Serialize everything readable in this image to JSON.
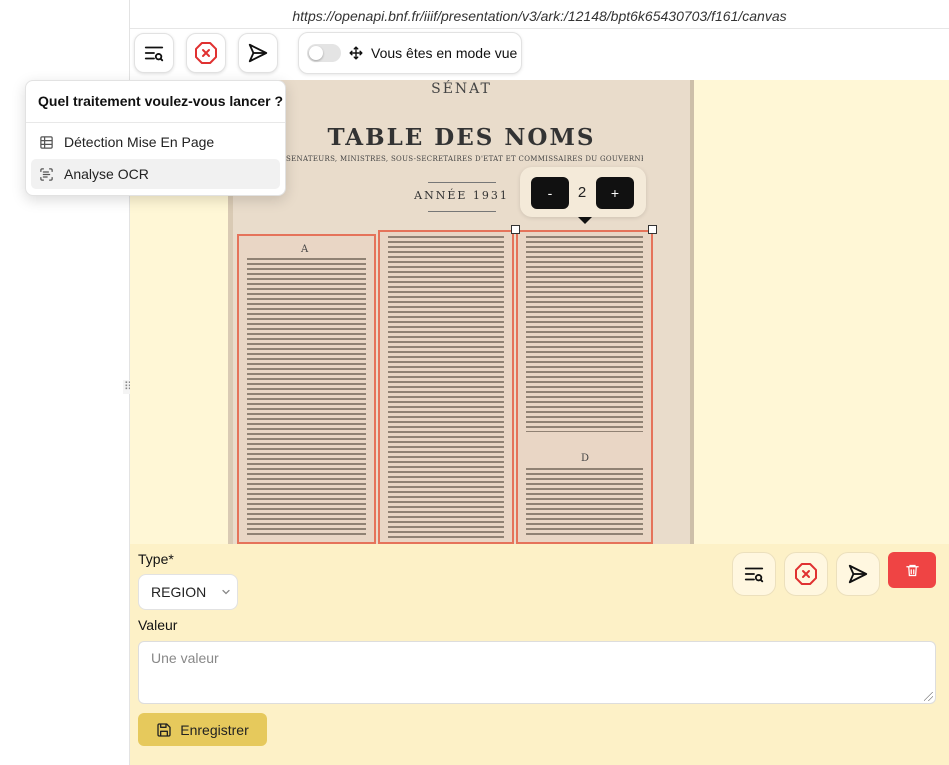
{
  "url": "https://openapi.bnf.fr/iiif/presentation/v3/ark:/12148/bpt6k65430703/f161/canvas",
  "toolbar": {
    "mode_label": "Vous êtes en mode vue",
    "icons": [
      "search-list-icon",
      "x-octagon-icon",
      "send-icon",
      "move-icon"
    ]
  },
  "menu": {
    "title": "Quel traitement voulez-vous lancer ?",
    "items": [
      {
        "label": "Détection Mise En Page",
        "icon": "table-icon"
      },
      {
        "label": "Analyse OCR",
        "icon": "scan-text-icon"
      }
    ]
  },
  "document": {
    "header": "SÉNAT",
    "title": "TABLE DES NOMS",
    "subtitle": "(SÉNATEURS, MINISTRES, SOUS-SECRÉTAIRES D'ÉTAT ET COMMISSAIRES DU GOUVERNEMENT)",
    "year": "ANNÉE 1931",
    "column_letters": [
      "A",
      "D"
    ]
  },
  "stepper": {
    "minus": "-",
    "value": "2",
    "plus": "+"
  },
  "form": {
    "type_label": "Type*",
    "type_value": "REGION",
    "value_label": "Valeur",
    "value_placeholder": "Une valeur",
    "save_label": "Enregistrer"
  },
  "colors": {
    "accent_yellow": "#e6c95c",
    "form_bg": "#fdf1c7",
    "viewer_bg": "#fff7d6",
    "region_border": "#e5735a",
    "delete_red": "#ef4444",
    "close_red": "#e03131"
  }
}
